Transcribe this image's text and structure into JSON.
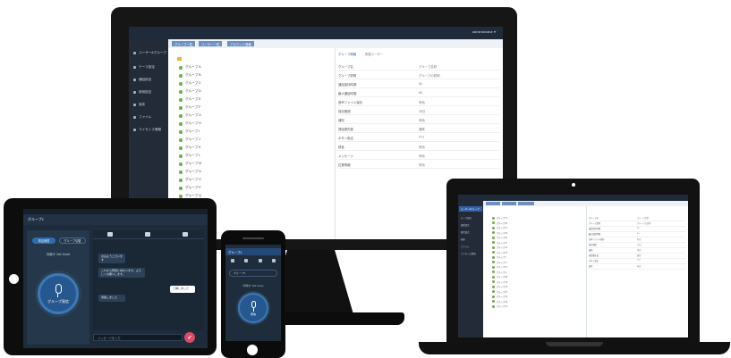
{
  "monitor": {
    "user": "administrator ▾",
    "sidebar": [
      {
        "label": "ユーザー&グループ",
        "active": true
      },
      {
        "label": "テーマ設定"
      },
      {
        "label": "通話設定"
      },
      {
        "label": "録音設定"
      },
      {
        "label": "端末"
      },
      {
        "label": "ファイル"
      },
      {
        "label": "ライセンス情報"
      }
    ],
    "tabs": [
      "グループ一覧",
      "ユーザー一覧",
      "アカウント情報"
    ],
    "list_items": [
      "グループ A",
      "グループ B",
      "グループ C",
      "グループ D",
      "グループ E",
      "グループ F",
      "グループ G",
      "グループ H",
      "グループ I",
      "グループ J",
      "グループ K",
      "グループ L",
      "グループ M",
      "グループ N",
      "グループ O",
      "グループ P",
      "グループ Q",
      "グループ R",
      "グループ S"
    ],
    "detail_tabs": [
      "グループ情報",
      "所属ユーザー"
    ],
    "detail_rows": [
      {
        "k": "グループ名",
        "v": "グループ名称"
      },
      {
        "k": "グループ説明",
        "v": "グループの説明"
      },
      {
        "k": "通話保持時間",
        "v": "60"
      },
      {
        "k": "最大通話時間",
        "v": "60"
      },
      {
        "k": "音声ファイル保存",
        "v": "有効"
      },
      {
        "k": "保存期間",
        "v": "30日"
      },
      {
        "k": "通知",
        "v": "有効"
      },
      {
        "k": "発話優先度",
        "v": "通常"
      },
      {
        "k": "ボタン設定",
        "v": "PTT"
      },
      {
        "k": "録音",
        "v": "有効"
      },
      {
        "k": "メッセージ",
        "v": "有効"
      },
      {
        "k": "位置情報",
        "v": "有効"
      }
    ]
  },
  "tablet": {
    "header": "グループ1",
    "chip_a": "発話権限",
    "chip_b": "グループ切替",
    "status": "待機中 Talk Mode",
    "mic_label": "グループ発信",
    "messages": [
      {
        "text": "おはようございます"
      },
      {
        "text": "これから現場に向かいます。よろしくお願いします。"
      },
      {
        "text": "了解しました"
      },
      {
        "text": "到着しました"
      }
    ],
    "input_placeholder": "メッセージを入力"
  },
  "phone": {
    "header": "グループ1",
    "select": "グループ1",
    "status": "待機中 Talk Mode",
    "mic_label": "発信"
  },
  "laptop": {
    "sidebar": [
      {
        "label": "ユーザー&グループ",
        "active": true
      },
      {
        "label": "テーマ設定"
      },
      {
        "label": "通話設定"
      },
      {
        "label": "録音設定"
      },
      {
        "label": "端末"
      },
      {
        "label": "ファイル"
      },
      {
        "label": "ライセンス情報"
      }
    ]
  },
  "colors": {
    "accent": "#2f5fa8",
    "dark_ui": "#1e2c3b",
    "send": "#e0486a"
  }
}
